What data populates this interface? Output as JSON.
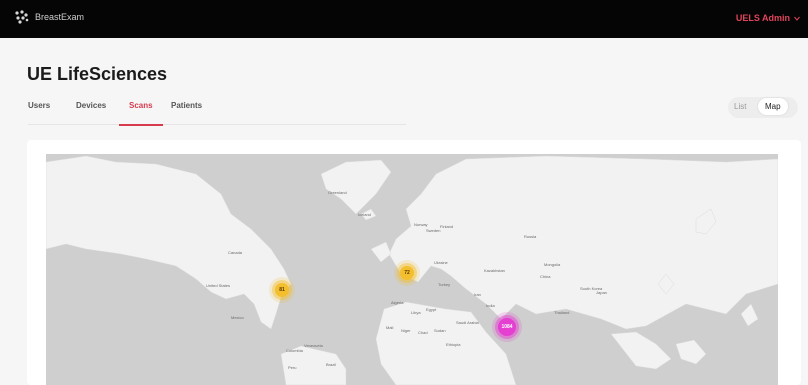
{
  "header": {
    "brand": "BreastExam",
    "user_menu": "UELS Admin",
    "icons": [
      "logo-icon",
      "chevron-down-icon"
    ]
  },
  "page": {
    "title": "UE LifeSciences"
  },
  "tabs": [
    {
      "label": "Users",
      "active": false
    },
    {
      "label": "Devices",
      "active": false
    },
    {
      "label": "Scans",
      "active": true
    },
    {
      "label": "Patients",
      "active": false
    }
  ],
  "view_toggle": {
    "list": "List",
    "map": "Map",
    "selected": "Map"
  },
  "map": {
    "clusters": [
      {
        "label": "81",
        "color": "#f3bf2e"
      },
      {
        "label": "72",
        "color": "#f3bf2e"
      },
      {
        "label": "1084",
        "color": "#e43fd0"
      }
    ],
    "place_labels": [
      "Greenland",
      "Iceland",
      "Canada",
      "United States",
      "Mexico",
      "Russia",
      "China",
      "India",
      "Saudi Arabia",
      "Egypt",
      "Libya",
      "Algeria",
      "Niger",
      "Chad",
      "Sudan",
      "Ethiopia",
      "Mali",
      "Kazakhstan",
      "Mongolia",
      "Iran",
      "Turkey",
      "Ukraine",
      "Norway",
      "Sweden",
      "Finland",
      "Colombia",
      "Venezuela",
      "Peru",
      "Brazil",
      "Thailand",
      "Japan",
      "South Korea"
    ]
  }
}
